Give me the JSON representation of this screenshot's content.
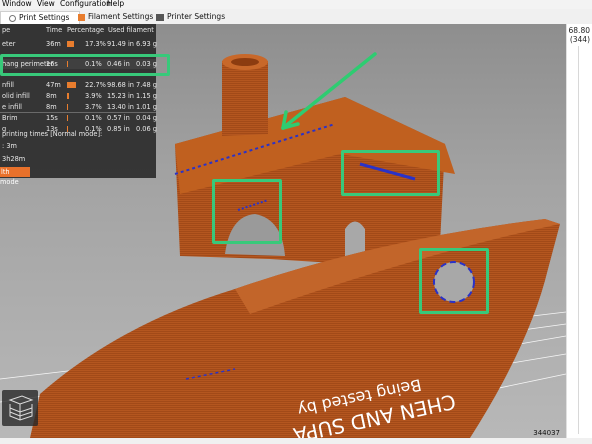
{
  "menu": [
    "Window",
    "View",
    "Configuration",
    "Help"
  ],
  "tabs": [
    {
      "label": "Print Settings",
      "icon": "gear-icon"
    },
    {
      "label": "Filament Settings",
      "icon": "filament-icon"
    },
    {
      "label": "Printer Settings",
      "icon": "printer-icon"
    }
  ],
  "legend": {
    "headers": [
      "pe",
      "Time",
      "Percentage",
      "Used filament"
    ],
    "rows": [
      {
        "name": "eter",
        "time": "36m",
        "pct": "17.3%",
        "len": "91.49 in",
        "wt": "6.93 g",
        "fill": 0.173
      },
      {
        "name": "hang perimeter",
        "time": "16s",
        "pct": "0.1%",
        "len": "0.46 in",
        "wt": "0.03 g",
        "fill": 0.001
      },
      {
        "name": "nfill",
        "time": "47m",
        "pct": "22.7%",
        "len": "98.68 in",
        "wt": "7.48 g",
        "fill": 0.227
      },
      {
        "name": "olid infill",
        "time": "8m",
        "pct": "3.9%",
        "len": "15.23 in",
        "wt": "1.15 g",
        "fill": 0.039
      },
      {
        "name": "e infill",
        "time": "8m",
        "pct": "3.7%",
        "len": "13.40 in",
        "wt": "1.01 g",
        "fill": 0.037
      },
      {
        "name": "Brim",
        "time": "15s",
        "pct": "0.1%",
        "len": "0.57 in",
        "wt": "0.04 g",
        "fill": 0.001
      },
      {
        "name": "g",
        "time": "13s",
        "pct": "0.1%",
        "len": "0.85 in",
        "wt": "0.06 g",
        "fill": 0.001
      }
    ],
    "times_title": "printing times [Normal mode]:",
    "time1": ": 3m",
    "time2": "3h28m",
    "mode_label": "lth mode"
  },
  "colors": {
    "accent": "#e87d2e",
    "highlight": "#38c97a",
    "model": "#b4561f",
    "overhang": "#2a32c8",
    "arrow": "#2ecc71"
  },
  "right_panel": {
    "value_top": "68.80",
    "value_layer": "(344)"
  },
  "viewport": {
    "vertex_count": "344037",
    "bed_text_1": "Being tested by",
    "bed_text_2": "CHEN AND SUPA"
  }
}
